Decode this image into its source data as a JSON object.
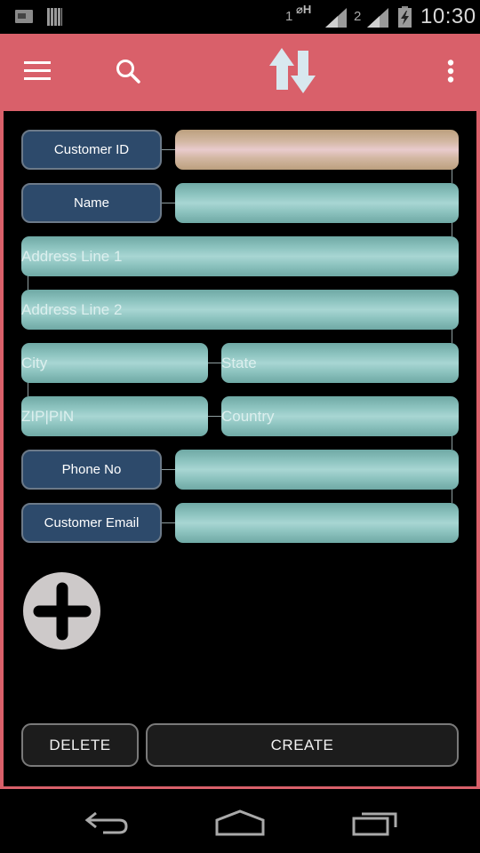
{
  "status_bar": {
    "sim1_label": "1",
    "data_indicator": "⌀H",
    "sim2_label": "2",
    "time": "10:30",
    "icons": [
      "screenshot-notification-icon",
      "barcode-notification-icon",
      "signal-icon",
      "signal-icon",
      "battery-charging-icon"
    ]
  },
  "action_bar": {
    "background": "#d9606a",
    "icons": [
      "menu-icon",
      "search-icon",
      "sort-icon",
      "overflow-menu-icon"
    ]
  },
  "form": {
    "customer_id": {
      "label": "Customer ID",
      "value": "",
      "placeholder": ""
    },
    "name": {
      "label": "Name",
      "value": "",
      "placeholder": ""
    },
    "address_line_1": {
      "value": "",
      "placeholder": "Address Line 1"
    },
    "address_line_2": {
      "value": "",
      "placeholder": "Address Line 2"
    },
    "city": {
      "value": "",
      "placeholder": "City"
    },
    "state": {
      "value": "",
      "placeholder": "State"
    },
    "zip": {
      "value": "",
      "placeholder": "ZIP|PIN"
    },
    "country": {
      "value": "",
      "placeholder": "Country"
    },
    "phone": {
      "label": "Phone No",
      "value": "",
      "placeholder": ""
    },
    "email": {
      "label": "Customer Email",
      "value": "",
      "placeholder": ""
    }
  },
  "add_button": {
    "icon": "plus-icon"
  },
  "buttons": {
    "delete_label": "DELETE",
    "create_label": "CREATE"
  },
  "nav_bar": {
    "icons": [
      "back-icon",
      "home-icon",
      "recent-apps-icon"
    ]
  },
  "colors": {
    "accent": "#d9606a",
    "label_bg": "#2d4a6b",
    "field_teal": "#8fc5c1",
    "field_tan": "#d3b8a4"
  }
}
